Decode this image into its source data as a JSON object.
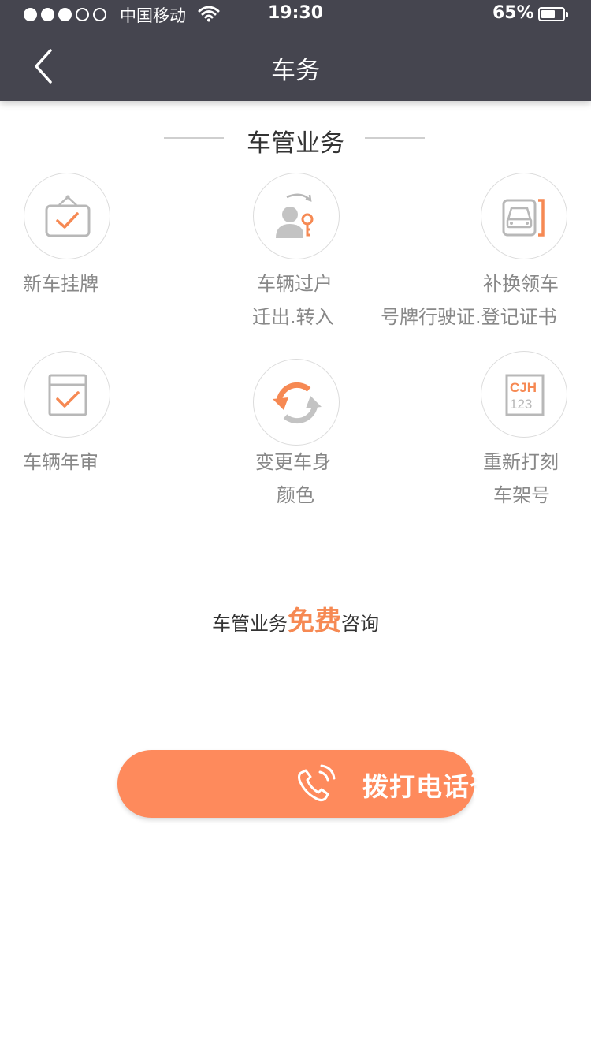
{
  "status_bar": {
    "carrier": "中国移动",
    "time": "19:30",
    "battery": "65%"
  },
  "nav": {
    "title": "车务"
  },
  "section": {
    "title": "车管业务"
  },
  "services": [
    {
      "line1": "新车挂牌",
      "line2": ""
    },
    {
      "line1": "车辆过户",
      "line2": "迁出.转入"
    },
    {
      "line1": "补换领车",
      "line2": "号牌行驶证.登记证书"
    },
    {
      "line1": "车辆年审",
      "line2": ""
    },
    {
      "line1": "变更车身",
      "line2": "颜色"
    },
    {
      "line1": "重新打刻",
      "line2": "车架号"
    }
  ],
  "plate_icon": {
    "top": "CJH",
    "bottom": "123"
  },
  "consult": {
    "prefix": "车管业务",
    "highlight": "免费",
    "suffix": "咨询"
  },
  "call_button": {
    "label": "拨打电话咨询"
  },
  "colors": {
    "header_bg": "#45454f",
    "accent": "#f68953",
    "button": "#fe8a5c",
    "icon_gray": "#b8b8b8"
  }
}
